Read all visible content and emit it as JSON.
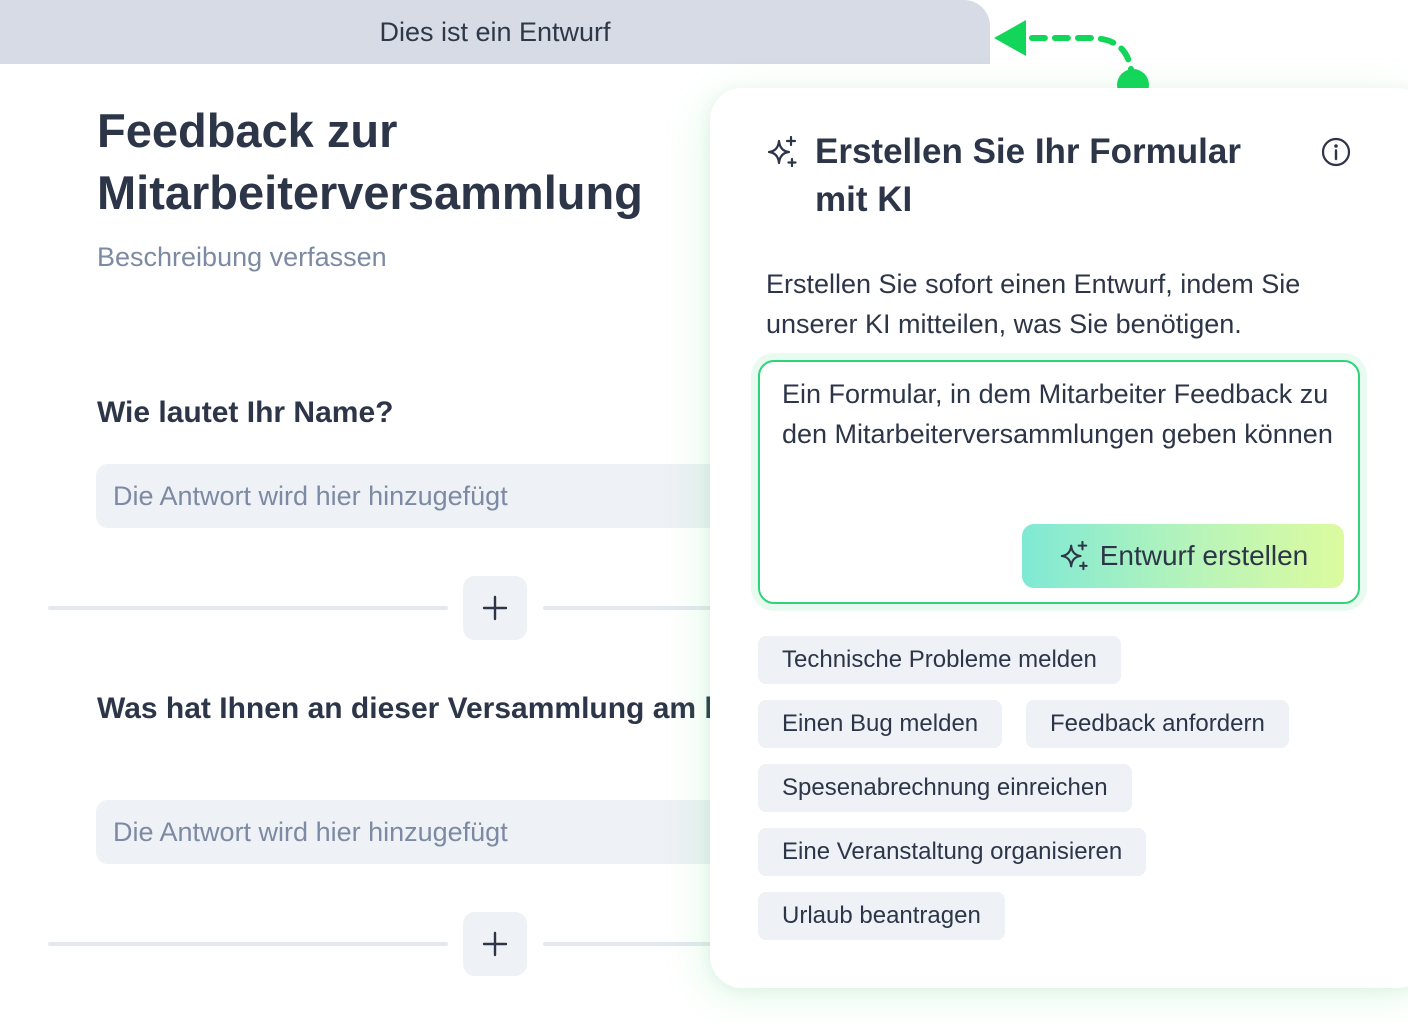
{
  "form": {
    "draft_banner": "Dies ist ein Entwurf",
    "title": "Feedback zur Mitarbeiterversammlung",
    "description_placeholder": "Beschreibung verfassen",
    "questions": [
      {
        "label": "Wie lautet Ihr Name?",
        "answer_placeholder": "Die Antwort wird hier hinzugefügt"
      },
      {
        "label": "Was hat Ihnen an dieser Versammlung am besten gefallen?",
        "answer_placeholder": "Die Antwort wird hier hinzugefügt"
      }
    ],
    "add_icon": "plus-icon"
  },
  "ai_panel": {
    "icon": "sparkle-icon",
    "title": "Erstellen Sie Ihr Formular mit KI",
    "info_icon": "info-icon",
    "subtitle": "Erstellen Sie sofort einen Entwurf, indem Sie unserer KI mitteilen, was Sie benötigen.",
    "prompt": "Ein Formular, in dem Mitarbeiter Feedback zu den Mitarbeiterversammlungen geben können",
    "generate_label": "Entwurf erstellen",
    "suggestions": [
      "Technische Probleme melden",
      "Einen Bug melden",
      "Feedback anfordern",
      "Spesenabrechnung einreichen",
      "Eine Veranstaltung organisieren",
      "Urlaub beantragen"
    ]
  },
  "colors": {
    "accent_green": "#12d65a",
    "banner_bg": "#d6dbe5",
    "text": "#2d3648",
    "muted": "#7d8aa3",
    "field_bg": "#eef1f5"
  }
}
